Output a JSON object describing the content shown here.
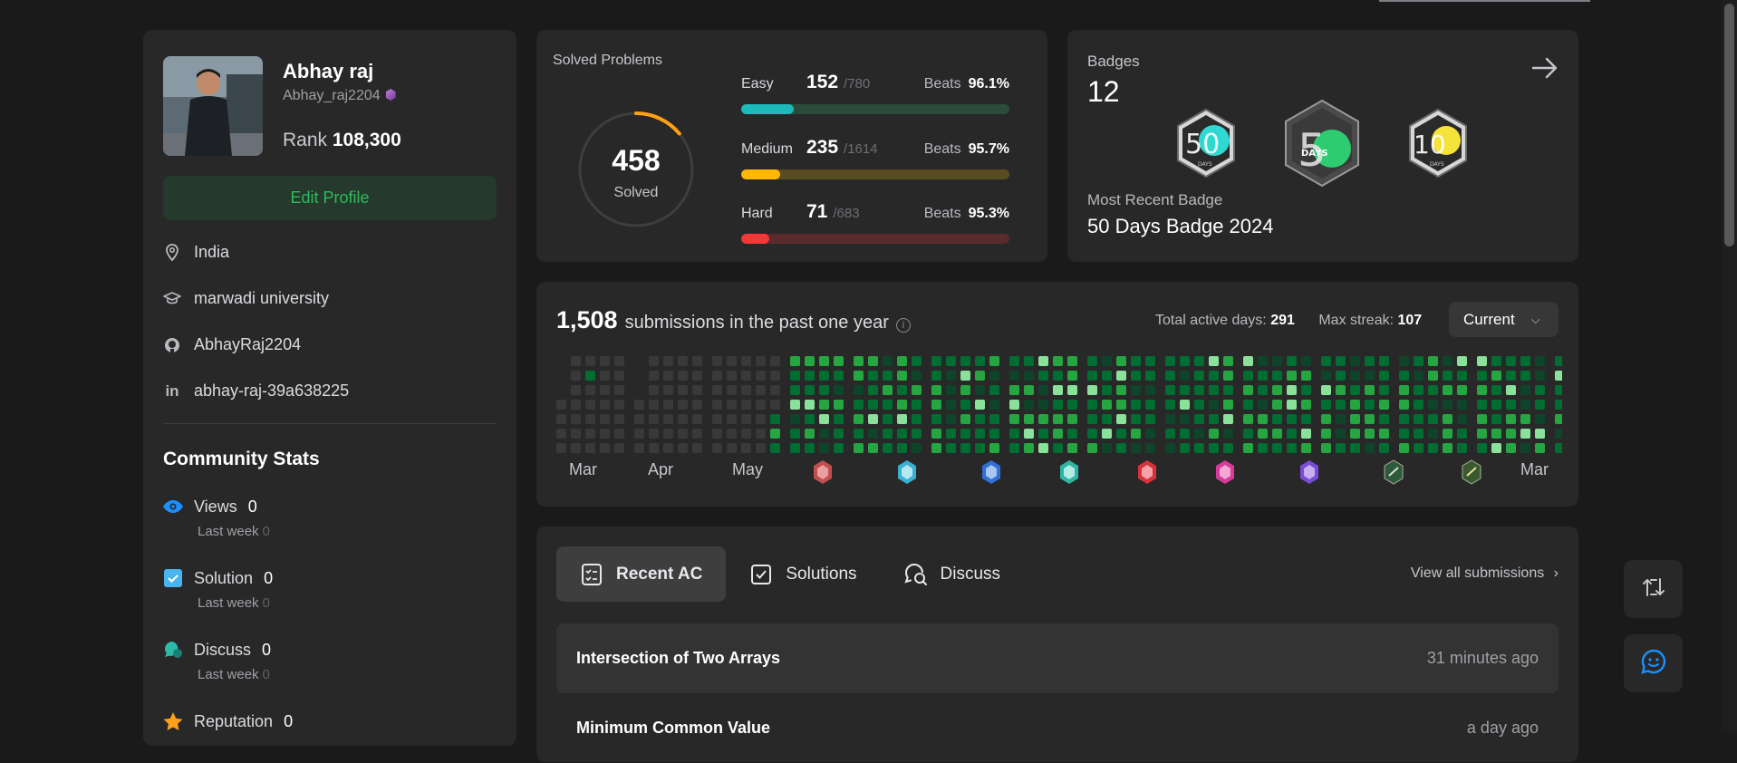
{
  "profile": {
    "name": "Abhay raj",
    "username": "Abhay_raj2204",
    "rank_label": "Rank",
    "rank_value": "108,300",
    "edit_label": "Edit Profile",
    "location": "India",
    "school": "marwadi university",
    "github": "AbhayRaj2204",
    "linkedin": "abhay-raj-39a638225"
  },
  "community": {
    "title": "Community Stats",
    "last_week_label": "Last week",
    "items": [
      {
        "label": "Views",
        "value": "0",
        "last_week": "0",
        "icon": "eye-icon",
        "color": "#1a90ff"
      },
      {
        "label": "Solution",
        "value": "0",
        "last_week": "0",
        "icon": "check-square-icon",
        "color": "#48b4f0"
      },
      {
        "label": "Discuss",
        "value": "0",
        "last_week": "0",
        "icon": "discuss-icon",
        "color": "#2cbbaa"
      },
      {
        "label": "Reputation",
        "value": "0",
        "icon": "star-icon",
        "color": "#ffa116"
      }
    ]
  },
  "solved": {
    "title": "Solved Problems",
    "total": "458",
    "total_label": "Solved",
    "total_fraction": 0.14,
    "beats_label": "Beats",
    "difficulties": [
      {
        "name": "Easy",
        "count": "152",
        "total": "/780",
        "beats": "96.1%",
        "fraction": 0.195,
        "color": "#1cbaba",
        "track": "#2b4b3b"
      },
      {
        "name": "Medium",
        "count": "235",
        "total": "/1614",
        "beats": "95.7%",
        "fraction": 0.146,
        "color": "#ffb700",
        "track": "#5a4c21"
      },
      {
        "name": "Hard",
        "count": "71",
        "total": "/683",
        "beats": "95.3%",
        "fraction": 0.104,
        "color": "#f63737",
        "track": "#5a2a2c"
      }
    ]
  },
  "badges": {
    "title": "Badges",
    "count": "12",
    "recent_label": "Most Recent Badge",
    "recent_name": "50 Days Badge 2024",
    "items": [
      {
        "icon": "50-days-badge-icon",
        "text": "50",
        "sub": "DAYS",
        "color": "#2fd8d0"
      },
      {
        "icon": "50-days-badge-2024-icon",
        "text": "5",
        "sub": "DAYS",
        "color": "#2ecc71"
      },
      {
        "icon": "100-days-badge-icon",
        "text": "10",
        "sub": "DAYS",
        "color": "#f5e33a"
      }
    ]
  },
  "heatmap": {
    "count": "1,508",
    "label": "submissions in the past one year",
    "info_icon": "i",
    "active_days_label": "Total active days:",
    "active_days": "291",
    "max_streak_label": "Max streak:",
    "max_streak": "107",
    "select_value": "Current",
    "months": [
      "Mar",
      "Apr",
      "May",
      "Mar"
    ],
    "colors": {
      "empty": "#393939",
      "l1": "#0e4429",
      "l2": "#006d32",
      "l3": "#26a641",
      "l4": "#8ae29a"
    }
  },
  "recent": {
    "tabs": [
      {
        "label": "Recent AC",
        "icon": "list-check-icon"
      },
      {
        "label": "Solutions",
        "icon": "checkbox-icon"
      },
      {
        "label": "Discuss",
        "icon": "discuss-search-icon"
      }
    ],
    "view_all": "View all submissions",
    "rows": [
      {
        "title": "Intersection of Two Arrays",
        "time": "31 minutes ago"
      },
      {
        "title": "Minimum Common Value",
        "time": "a day ago"
      }
    ]
  }
}
